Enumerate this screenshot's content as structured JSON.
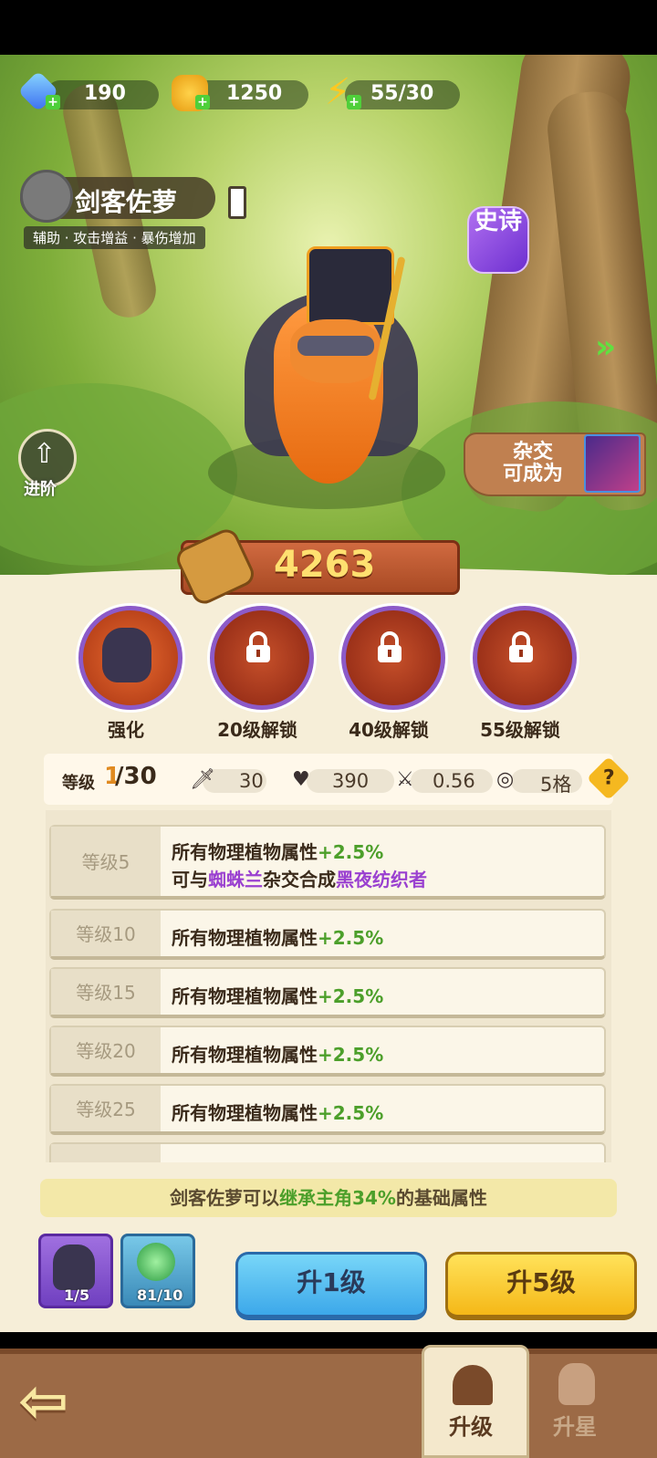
{
  "resources": {
    "gems": "190",
    "coins": "1250",
    "energy": "55/30"
  },
  "hero": {
    "name": "剑客佐萝",
    "tags": "辅助 · 攻击增益 · 暴伤增加",
    "rarity": "史诗",
    "power": "4263"
  },
  "actions": {
    "advance": "进阶",
    "hybrid_label_1": "杂交",
    "hybrid_label_2": "可成为"
  },
  "skills": [
    {
      "label": "强化",
      "locked": false
    },
    {
      "label": "20级解锁",
      "locked": true
    },
    {
      "label": "40级解锁",
      "locked": true
    },
    {
      "label": "55级解锁",
      "locked": true
    }
  ],
  "stats": {
    "level_label": "等级",
    "level_current": "1",
    "level_max": "/30",
    "attack": "30",
    "hp": "390",
    "speed": "0.56",
    "range": "5格",
    "help": "?"
  },
  "level_rows": [
    {
      "level": "等级5",
      "text": "所有物理植物属性",
      "bonus": "+2.5%",
      "line2_a": "可与",
      "line2_b": "蜘蛛兰",
      "line2_c": "杂交合成",
      "line2_d": "黑夜纺织者"
    },
    {
      "level": "等级10",
      "text": "所有物理植物属性",
      "bonus": "+2.5%"
    },
    {
      "level": "等级15",
      "text": "所有物理植物属性",
      "bonus": "+2.5%"
    },
    {
      "level": "等级20",
      "text": "所有物理植物属性",
      "bonus": "+2.5%"
    },
    {
      "level": "等级25",
      "text": "所有物理植物属性",
      "bonus": "+2.5%"
    }
  ],
  "inherit": {
    "a": "剑客佐萝可以",
    "b": "继承主角34%",
    "c": "的基础属性"
  },
  "items": {
    "card_count": "1/5",
    "seed_count": "81/10"
  },
  "buttons": {
    "up1": "升1级",
    "up5": "升5级"
  },
  "nav": {
    "back": "⇦",
    "tab_upgrade": "升级",
    "tab_star": "升星"
  },
  "colors": {
    "green_bonus": "#4c9f2a",
    "purple_highlight": "#9a40d0",
    "level_current": "#e08a20"
  }
}
